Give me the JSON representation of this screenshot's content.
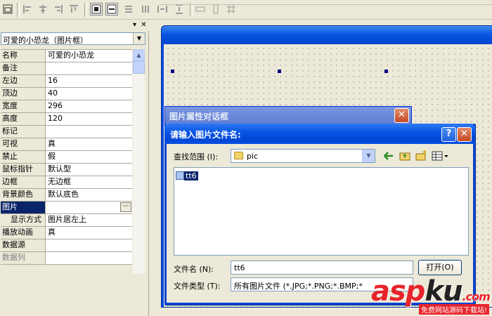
{
  "colors": {
    "selection": "#0a246a",
    "xp_blue": "#0a56e6",
    "close_red": "#c24a26",
    "watermark_red": "#e8242b"
  },
  "toolbar": {
    "icons": [
      "window-icon",
      "align-left-icon",
      "align-center-icon",
      "align-right-icon",
      "align-top-icon",
      "align-middle-icon",
      "align-bottom-icon",
      "center-horizontal-icon",
      "center-vertical-icon",
      "same-width-icon",
      "same-height-icon",
      "h-spacing-icon",
      "v-spacing-icon",
      "resize-width-icon",
      "resize-height-icon",
      "grid-icon"
    ]
  },
  "panel": {
    "pin_label": "▾",
    "close_label": "✕",
    "object_selector": "可爱的小恐龙（图片框）",
    "properties": [
      {
        "key": "名称",
        "value": "可爱的小恐龙",
        "state": "normal"
      },
      {
        "key": "备注",
        "value": "",
        "state": "normal"
      },
      {
        "key": "左边",
        "value": "16",
        "state": "normal"
      },
      {
        "key": "顶边",
        "value": "40",
        "state": "normal"
      },
      {
        "key": "宽度",
        "value": "296",
        "state": "normal"
      },
      {
        "key": "高度",
        "value": "120",
        "state": "normal"
      },
      {
        "key": "标记",
        "value": "",
        "state": "normal"
      },
      {
        "key": "可视",
        "value": "真",
        "state": "normal"
      },
      {
        "key": "禁止",
        "value": "假",
        "state": "normal"
      },
      {
        "key": "鼠标指针",
        "value": "默认型",
        "state": "normal"
      },
      {
        "key": "边框",
        "value": "无边框",
        "state": "normal"
      },
      {
        "key": "背景颜色",
        "value": "默认底色",
        "state": "normal"
      },
      {
        "key": "图片",
        "value": "",
        "state": "selected"
      },
      {
        "key": "显示方式",
        "value": "图片居左上",
        "state": "indent"
      },
      {
        "key": "播放动画",
        "value": "真",
        "state": "normal"
      },
      {
        "key": "数据源",
        "value": "",
        "state": "normal"
      },
      {
        "key": "数据列",
        "value": "",
        "state": "dim"
      }
    ],
    "ellipsis_label": "···"
  },
  "dialog_back": {
    "title": "图片属性对话框",
    "close_label": "✕"
  },
  "dialog": {
    "title": "请输入图片文件名:",
    "help_label": "?",
    "close_label": "✕",
    "lookin_label": "查找范围 (I):",
    "lookin_value": "pic",
    "files": [
      "tt6"
    ],
    "filename_label": "文件名 (N):",
    "filename_value": "tt6",
    "open_label": "打开(O)",
    "filetype_label": "文件类型 (T):",
    "filetype_value": "所有图片文件 (*.JPG;*.PNG;*.BMP;*"
  },
  "watermark": {
    "logo_red": "asp",
    "logo_dark": "ku",
    "logo_suffix": ".com",
    "tagline": "免费网站源码下载站!"
  }
}
